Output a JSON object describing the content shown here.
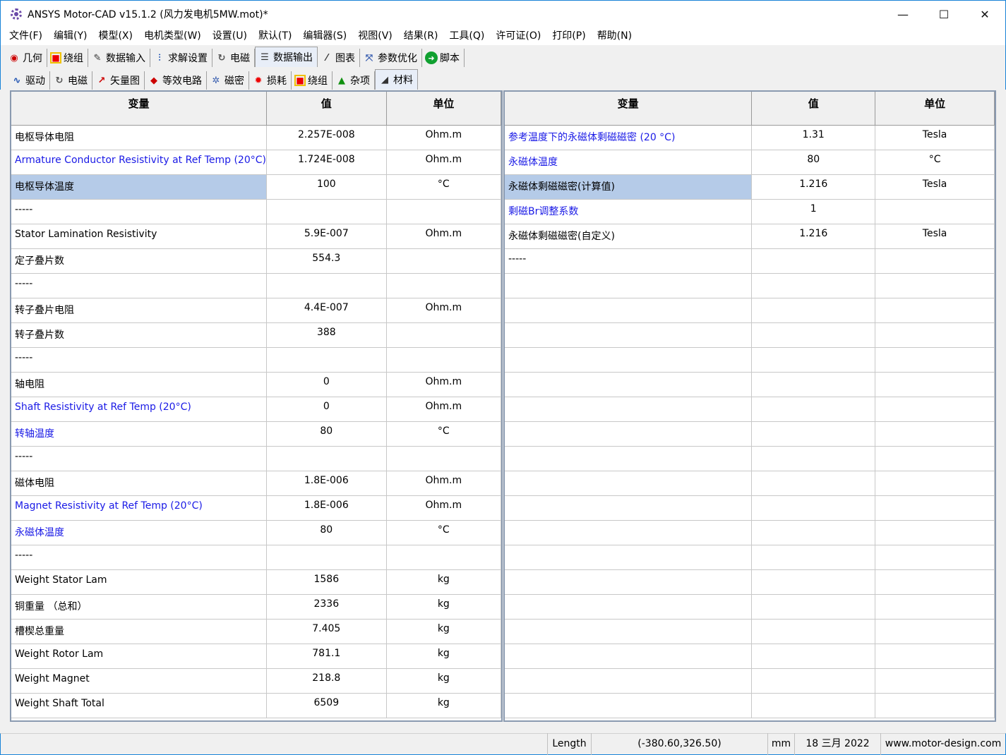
{
  "window": {
    "title": "ANSYS Motor-CAD v15.1.2 (风力发电机5MW.mot)*",
    "minimize": "—",
    "maximize": "☐",
    "close": "✕"
  },
  "menu": [
    "文件(F)",
    "编辑(Y)",
    "模型(X)",
    "电机类型(W)",
    "设置(U)",
    "默认(T)",
    "编辑器(S)",
    "视图(V)",
    "结果(R)",
    "工具(Q)",
    "许可证(O)",
    "打印(P)",
    "帮助(N)"
  ],
  "tabs_main": [
    {
      "label": "几何",
      "icon": "geometry-icon"
    },
    {
      "label": "绕组",
      "icon": "winding-icon"
    },
    {
      "label": "数据输入",
      "icon": "data-input-icon"
    },
    {
      "label": "求解设置",
      "icon": "solver-settings-icon"
    },
    {
      "label": "电磁",
      "icon": "electromagnetic-icon"
    },
    {
      "label": "数据输出",
      "icon": "data-output-icon"
    },
    {
      "label": "图表",
      "icon": "chart-icon"
    },
    {
      "label": "参数优化",
      "icon": "optimization-icon"
    },
    {
      "label": "脚本",
      "icon": "script-icon"
    }
  ],
  "tabs_sub": [
    {
      "label": "驱动",
      "icon": "drive-icon"
    },
    {
      "label": "电磁",
      "icon": "electromagnetic-icon"
    },
    {
      "label": "矢量图",
      "icon": "vector-diagram-icon"
    },
    {
      "label": "等效电路",
      "icon": "equivalent-circuit-icon"
    },
    {
      "label": "磁密",
      "icon": "flux-density-icon"
    },
    {
      "label": "损耗",
      "icon": "losses-icon"
    },
    {
      "label": "绕组",
      "icon": "winding-icon"
    },
    {
      "label": "杂项",
      "icon": "misc-icon"
    },
    {
      "label": "材料",
      "icon": "materials-icon"
    }
  ],
  "grid_left": {
    "headers": {
      "name": "变量",
      "value": "值",
      "unit": "单位"
    },
    "rows": [
      {
        "name": "电枢导体电阻",
        "value": "2.257E-008",
        "unit": "Ohm.m"
      },
      {
        "name": "Armature Conductor Resistivity at Ref Temp (20°C)",
        "value": "1.724E-008",
        "unit": "Ohm.m"
      },
      {
        "name": "电枢导体温度",
        "value": "100",
        "unit": "°C"
      },
      {
        "name": "-----",
        "value": "",
        "unit": ""
      },
      {
        "name": "Stator Lamination Resistivity",
        "value": "5.9E-007",
        "unit": "Ohm.m"
      },
      {
        "name": "定子叠片数",
        "value": "554.3",
        "unit": ""
      },
      {
        "name": "-----",
        "value": "",
        "unit": ""
      },
      {
        "name": "转子叠片电阻",
        "value": "4.4E-007",
        "unit": "Ohm.m"
      },
      {
        "name": "转子叠片数",
        "value": "388",
        "unit": ""
      },
      {
        "name": "-----",
        "value": "",
        "unit": ""
      },
      {
        "name": "轴电阻",
        "value": "0",
        "unit": "Ohm.m"
      },
      {
        "name": "Shaft Resistivity at Ref Temp (20°C)",
        "value": "0",
        "unit": "Ohm.m"
      },
      {
        "name": "转轴温度",
        "value": "80",
        "unit": "°C"
      },
      {
        "name": "-----",
        "value": "",
        "unit": ""
      },
      {
        "name": "磁体电阻",
        "value": "1.8E-006",
        "unit": "Ohm.m"
      },
      {
        "name": "Magnet Resistivity at Ref Temp (20°C)",
        "value": "1.8E-006",
        "unit": "Ohm.m"
      },
      {
        "name": "永磁体温度",
        "value": "80",
        "unit": "°C"
      },
      {
        "name": "-----",
        "value": "",
        "unit": ""
      },
      {
        "name": "Weight Stator Lam",
        "value": "1586",
        "unit": "kg"
      },
      {
        "name": "铜重量 （总和）",
        "value": "2336",
        "unit": "kg"
      },
      {
        "name": "槽楔总重量",
        "value": "7.405",
        "unit": "kg"
      },
      {
        "name": "Weight Rotor Lam",
        "value": "781.1",
        "unit": "kg"
      },
      {
        "name": "Weight Magnet",
        "value": "218.8",
        "unit": "kg"
      },
      {
        "name": "Weight Shaft Total",
        "value": "6509",
        "unit": "kg"
      }
    ]
  },
  "grid_right": {
    "headers": {
      "name": "变量",
      "value": "值",
      "unit": "单位"
    },
    "rows": [
      {
        "name": "参考温度下的永磁体剩磁磁密 (20 °C)",
        "value": "1.31",
        "unit": "Tesla"
      },
      {
        "name": "永磁体温度",
        "value": "80",
        "unit": "°C"
      },
      {
        "name": "永磁体剩磁磁密(计算值)",
        "value": "1.216",
        "unit": "Tesla"
      },
      {
        "name": "剩磁Br调整系数",
        "value": "1",
        "unit": ""
      },
      {
        "name": "永磁体剩磁磁密(自定义)",
        "value": "1.216",
        "unit": "Tesla"
      },
      {
        "name": "-----",
        "value": "",
        "unit": ""
      },
      {
        "name": "",
        "value": "",
        "unit": ""
      },
      {
        "name": "",
        "value": "",
        "unit": ""
      },
      {
        "name": "",
        "value": "",
        "unit": ""
      },
      {
        "name": "",
        "value": "",
        "unit": ""
      },
      {
        "name": "",
        "value": "",
        "unit": ""
      },
      {
        "name": "",
        "value": "",
        "unit": ""
      },
      {
        "name": "",
        "value": "",
        "unit": ""
      },
      {
        "name": "",
        "value": "",
        "unit": ""
      },
      {
        "name": "",
        "value": "",
        "unit": ""
      },
      {
        "name": "",
        "value": "",
        "unit": ""
      },
      {
        "name": "",
        "value": "",
        "unit": ""
      },
      {
        "name": "",
        "value": "",
        "unit": ""
      },
      {
        "name": "",
        "value": "",
        "unit": ""
      },
      {
        "name": "",
        "value": "",
        "unit": ""
      },
      {
        "name": "",
        "value": "",
        "unit": ""
      },
      {
        "name": "",
        "value": "",
        "unit": ""
      },
      {
        "name": "",
        "value": "",
        "unit": ""
      },
      {
        "name": "",
        "value": "",
        "unit": ""
      }
    ]
  },
  "statusbar": {
    "label": "Length",
    "coords": "(-380.60,326.50)",
    "units": "mm",
    "date": "18 三月 2022",
    "website": "www.motor-design.com"
  },
  "colors": {
    "link_blue": "#1a1ae6",
    "highlight": "#b5cbe8"
  }
}
